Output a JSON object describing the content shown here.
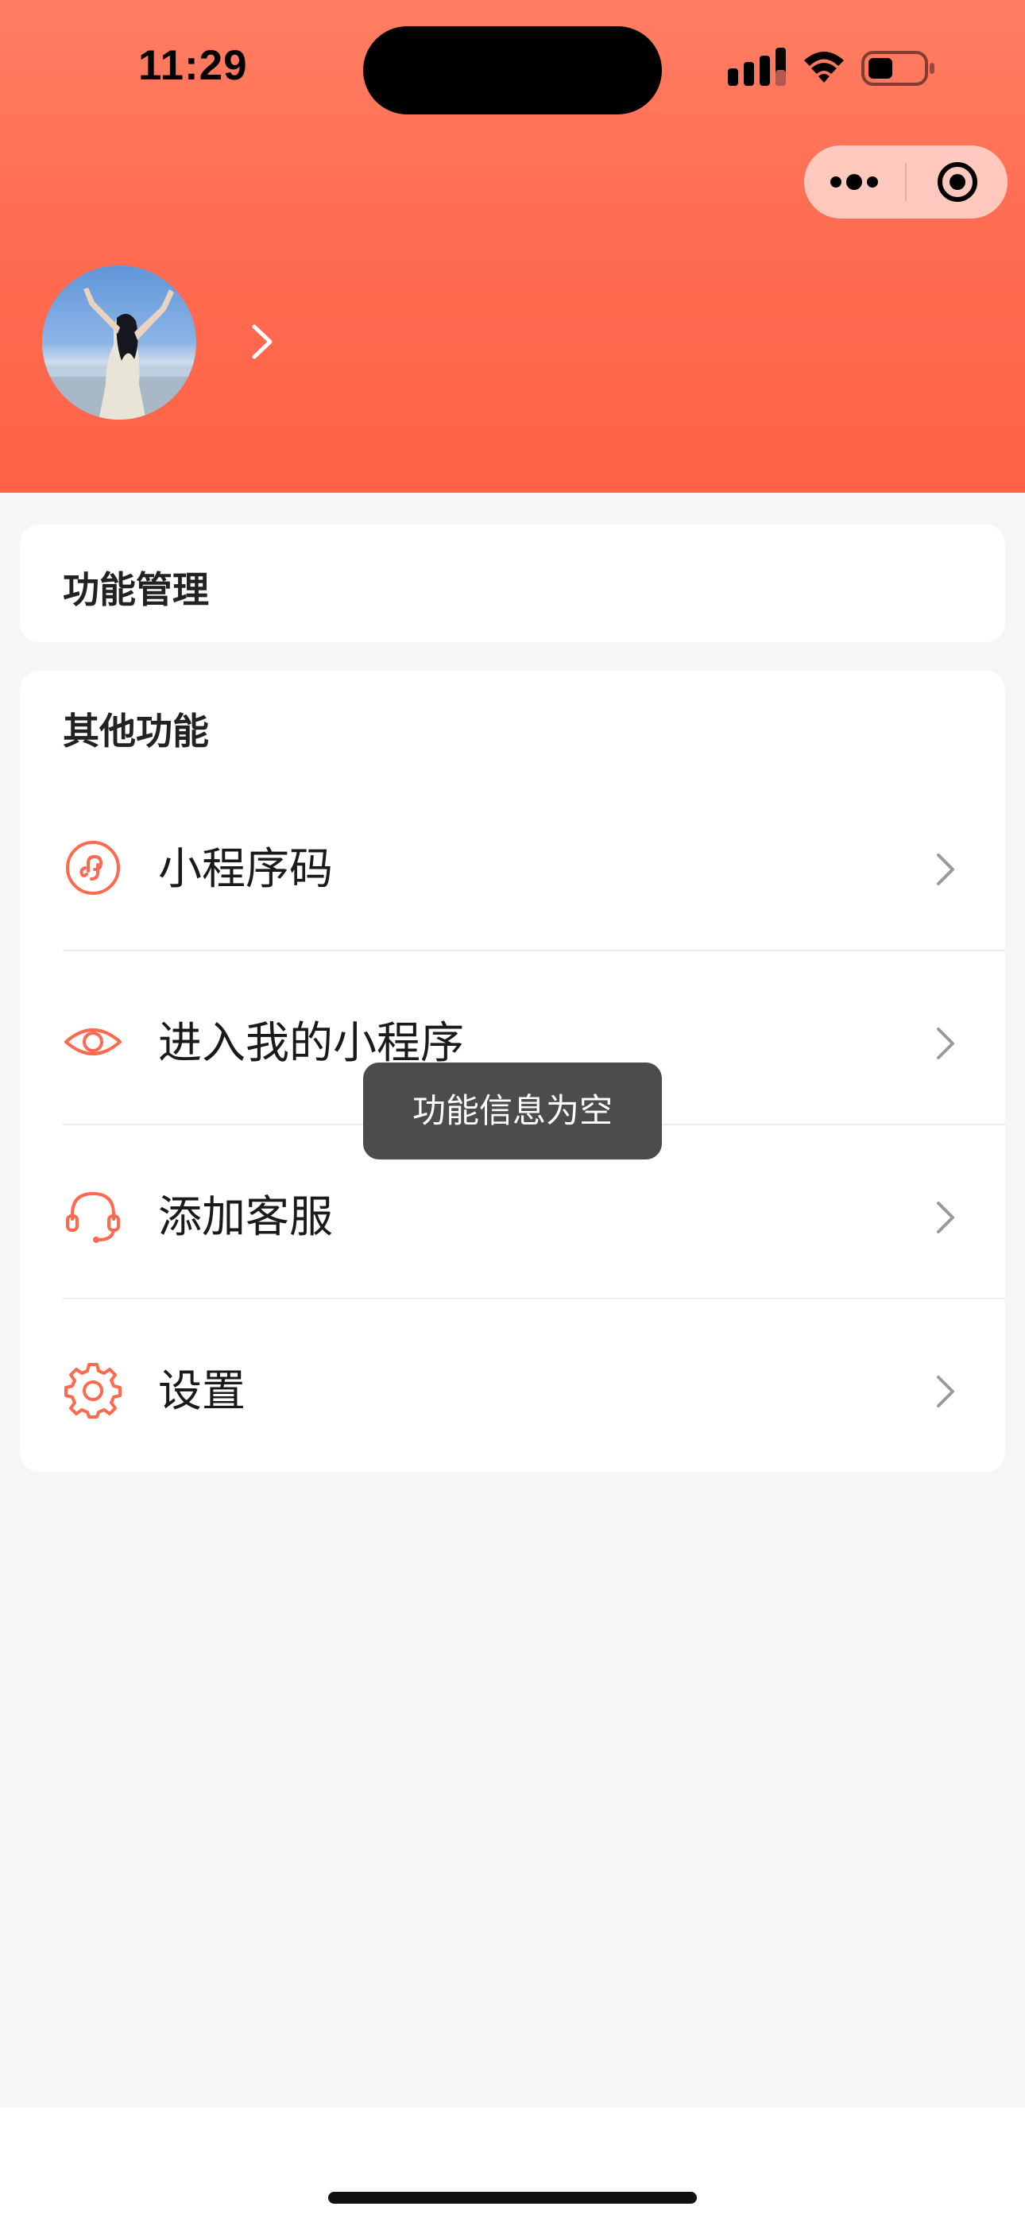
{
  "status_bar": {
    "time": "11:29",
    "icons": [
      "cellular-signal-icon",
      "wifi-icon",
      "battery-icon"
    ]
  },
  "capsule": {
    "icons": [
      "more-dots-icon",
      "close-target-icon"
    ]
  },
  "profile": {
    "name": ""
  },
  "cards": {
    "function_management": {
      "title": "功能管理"
    },
    "other_functions": {
      "title": "其他功能",
      "items": [
        {
          "label": "小程序码",
          "icon": "link-circle-icon"
        },
        {
          "label": "进入我的小程序",
          "icon": "eye-icon"
        },
        {
          "label": "添加客服",
          "icon": "headset-icon"
        },
        {
          "label": "设置",
          "icon": "gear-icon"
        }
      ]
    }
  },
  "toast": {
    "message": "功能信息为空"
  },
  "colors": {
    "accent": "#ff6a4f",
    "header_gradient_top": "#ff7e63",
    "header_gradient_bottom": "#ff6247",
    "background": "#f6f6f6",
    "toast_bg": "#4c4c4c"
  }
}
